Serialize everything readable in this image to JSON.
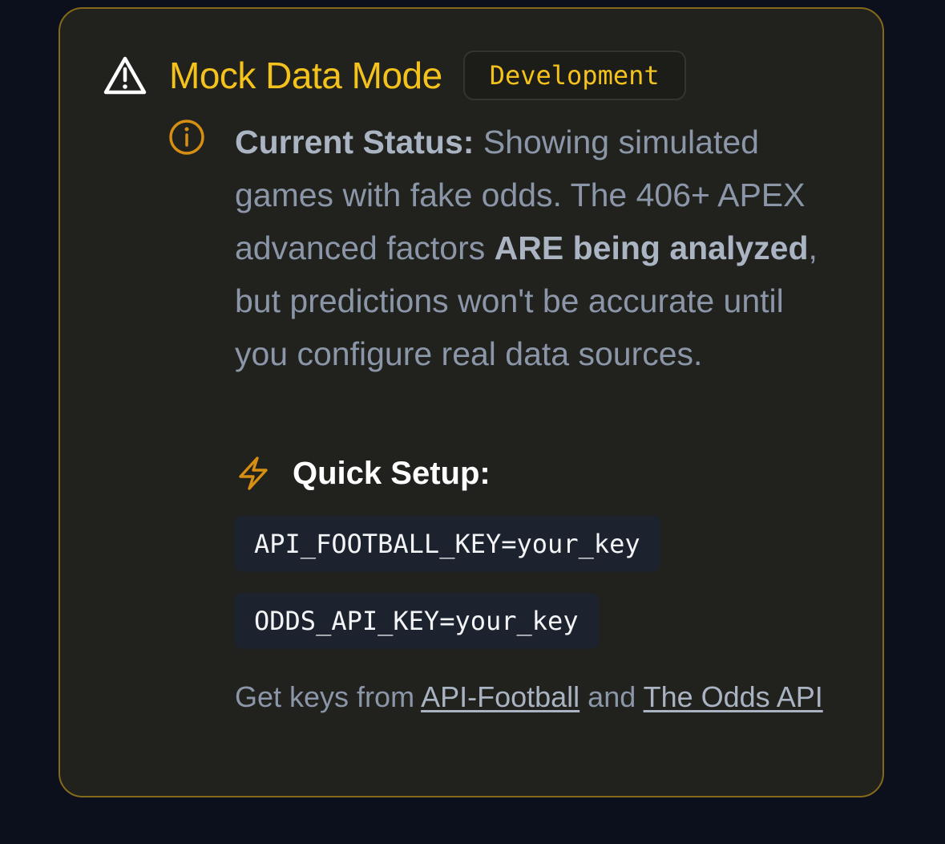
{
  "header": {
    "title": "Mock Data Mode",
    "badge": "Development"
  },
  "status": {
    "label": "Current Status:",
    "text_1": " Showing simulated games with fake odds. The 406+ APEX advanced factors ",
    "emphasis": "ARE being analyzed",
    "text_2": ", but predictions won't be accurate until you configure real data sources."
  },
  "setup": {
    "title": "Quick Setup:",
    "code_1": "API_FOOTBALL_KEY=your_key",
    "code_2": "ODDS_API_KEY=your_key"
  },
  "footer": {
    "prefix": "Get keys from ",
    "link_1": "API-Football",
    "middle": " and ",
    "link_2": "The Odds API"
  },
  "icons": {
    "warning": "alert-triangle-icon",
    "info": "info-circle-icon",
    "setup": "lightning-bolt-icon"
  },
  "colors": {
    "background": "#0b101c",
    "card": "#21221e",
    "border": "#84691a",
    "accent": "#f4c21c",
    "icon_accent": "#d68f12",
    "text_muted": "#8b96a8",
    "text_strong": "#aab4c3",
    "code_background": "#1d222f"
  }
}
